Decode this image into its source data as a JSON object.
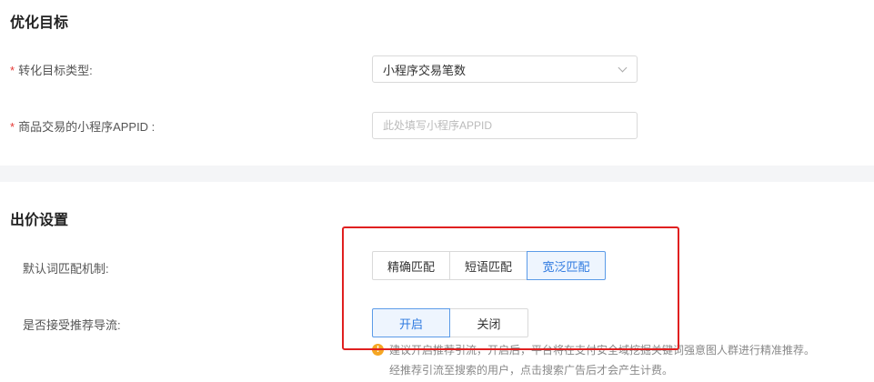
{
  "optimization": {
    "title": "优化目标",
    "conversion_type": {
      "required_mark": "*",
      "label": "转化目标类型:",
      "value": "小程序交易笔数"
    },
    "appid": {
      "required_mark": "*",
      "label": "商品交易的小程序APPID :",
      "value": "",
      "placeholder": "此处填写小程序APPID"
    }
  },
  "bidding": {
    "title": "出价设置",
    "match_mode": {
      "label": "默认词匹配机制:",
      "options": [
        "精确匹配",
        "短语匹配",
        "宽泛匹配"
      ],
      "selected": "宽泛匹配"
    },
    "recommend_traffic": {
      "label": "是否接受推荐导流:",
      "options": [
        "开启",
        "关闭"
      ],
      "selected": "开启"
    },
    "hint": {
      "line1": "建议开启推荐引流，开启后，平台将在支付安全域挖掘关键词强意图人群进行精准推荐。",
      "line2": "经推荐引流至搜索的用户，点击搜索广告后才会产生计费。"
    }
  },
  "colors": {
    "accent": "#2f7ae0",
    "required": "#e53935",
    "highlight_border": "#e02020",
    "warning": "#f5a623"
  }
}
